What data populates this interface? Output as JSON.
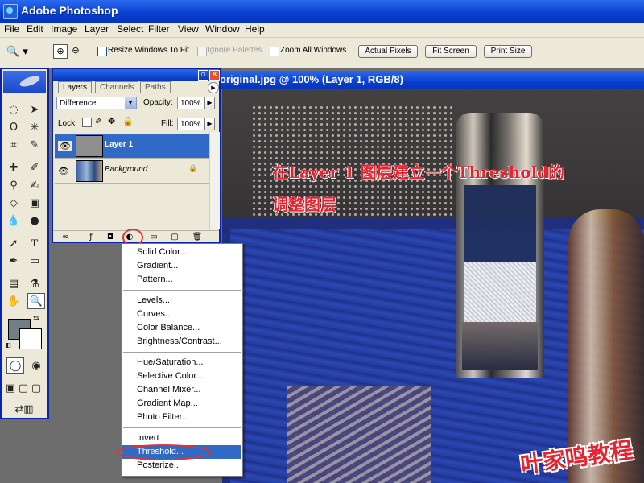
{
  "app": {
    "title": "Adobe Photoshop"
  },
  "menu": [
    "File",
    "Edit",
    "Image",
    "Layer",
    "Select",
    "Filter",
    "View",
    "Window",
    "Help"
  ],
  "options": {
    "resize_windows_label": "Resize Windows To Fit",
    "ignore_palettes_label": "Ignore Palettes",
    "zoom_all_label": "Zoom All Windows",
    "actual_pixels": "Actual Pixels",
    "fit_screen": "Fit Screen",
    "print_size": "Print Size"
  },
  "document": {
    "title": "original.jpg @ 100% (Layer 1, RGB/8)",
    "annotation_line1": "在Layer 1 图层建立一个Threshold的",
    "annotation_line2": "调整图层",
    "watermark": "叶家鸣教程"
  },
  "layers_palette": {
    "tabs": [
      "Layers",
      "Channels",
      "Paths"
    ],
    "blend_mode": "Difference",
    "opacity_label": "Opacity:",
    "opacity_value": "100%",
    "lock_label": "Lock:",
    "fill_label": "Fill:",
    "fill_value": "100%",
    "layers": [
      {
        "name": "Layer 1",
        "selected": true
      },
      {
        "name": "Background",
        "selected": false,
        "locked": true
      }
    ]
  },
  "adjustment_menu": {
    "group1": [
      "Solid Color...",
      "Gradient...",
      "Pattern..."
    ],
    "group2": [
      "Levels...",
      "Curves...",
      "Color Balance...",
      "Brightness/Contrast..."
    ],
    "group3": [
      "Hue/Saturation...",
      "Selective Color...",
      "Channel Mixer...",
      "Gradient Map...",
      "Photo Filter..."
    ],
    "group4": [
      "Invert",
      "Threshold...",
      "Posterize..."
    ],
    "highlighted": "Threshold..."
  },
  "colors": {
    "titlebar": "#0a3fd0",
    "highlight": "#316ac5",
    "annotation": "#e8232f",
    "foreground_swatch": "#6f7f84",
    "background_swatch": "#ffffff"
  }
}
